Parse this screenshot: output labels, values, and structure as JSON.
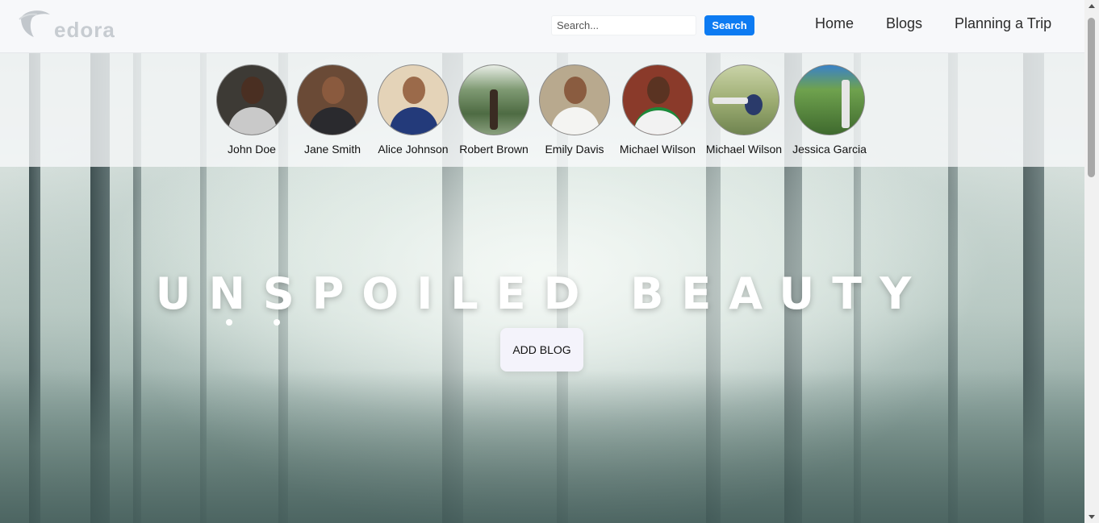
{
  "brand": {
    "logo_text": "edora"
  },
  "search": {
    "placeholder": "Search...",
    "button_label": "Search"
  },
  "nav": {
    "items": [
      {
        "label": "Home"
      },
      {
        "label": "Blogs"
      },
      {
        "label": "Planning a Trip"
      }
    ]
  },
  "profiles": [
    {
      "name": "John Doe"
    },
    {
      "name": "Jane Smith"
    },
    {
      "name": "Alice Johnson"
    },
    {
      "name": "Robert Brown"
    },
    {
      "name": "Emily Davis"
    },
    {
      "name": "Michael Wilson"
    },
    {
      "name": "Michael Wilson"
    },
    {
      "name": "Jessica Garcia"
    }
  ],
  "hero": {
    "title": "UNSPOILED BEAUTY",
    "button_label": "ADD BLOG"
  },
  "colors": {
    "accent": "#0d7bf2",
    "navbar_bg": "#f7f8fa",
    "title": "#ffffff"
  }
}
